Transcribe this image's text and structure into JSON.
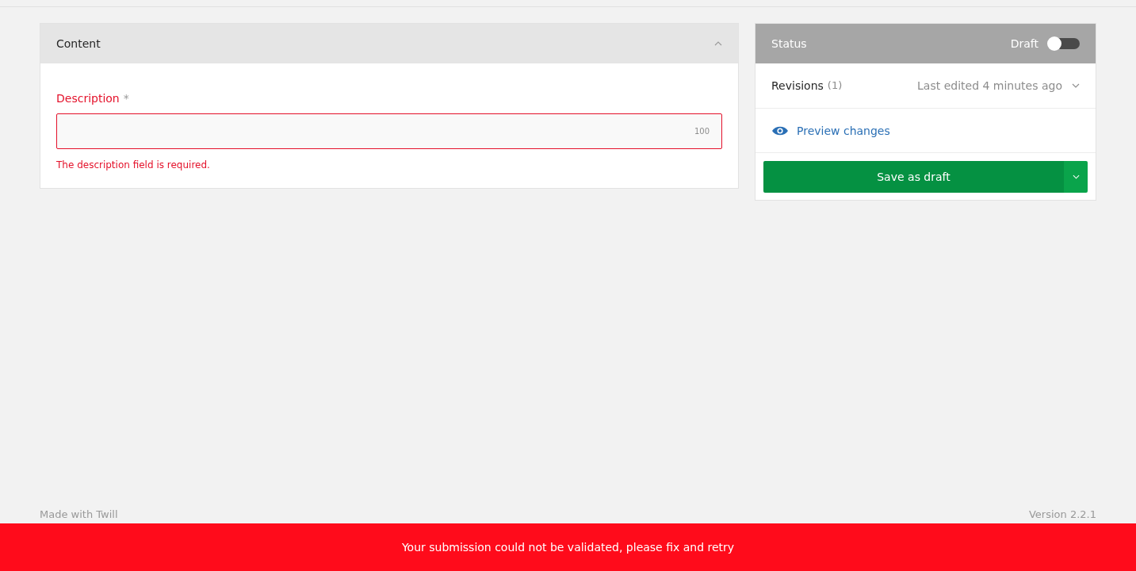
{
  "content_panel": {
    "title": "Content",
    "expanded": true,
    "field": {
      "label": "Description",
      "required_mark": "*",
      "counter": "100",
      "error": true,
      "error_message": "The description field is required."
    }
  },
  "status_panel": {
    "title": "Status",
    "toggle_label": "Draft",
    "published": false,
    "revisions": {
      "label": "Revisions",
      "count": "(1)",
      "last_edited": "Last edited 4 minutes ago"
    },
    "preview_link": "Preview changes",
    "save_button": "Save as draft"
  },
  "footer": {
    "left": "Made with Twill",
    "right": "Version 2.2.1"
  },
  "alert": "Your submission could not be validated, please fix and retry"
}
